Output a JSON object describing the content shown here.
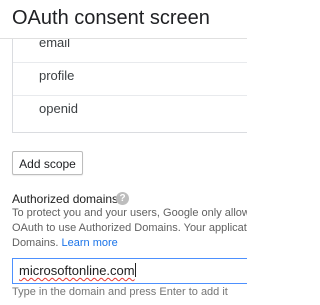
{
  "header": {
    "title": "OAuth consent screen"
  },
  "scopes": {
    "partial_item": "email",
    "items": [
      "profile",
      "openid"
    ],
    "add_button_label": "Add scope"
  },
  "authorized_domains": {
    "title": "Authorized domains",
    "help_glyph": "?",
    "description_line1": "To protect you and your users, Google only allow",
    "description_line2": "OAuth to use Authorized Domains. Your applicati",
    "description_line3_prefix": "Domains. ",
    "learn_more": "Learn more",
    "input_value": "microsoftonline.com",
    "hint": "Type in the domain and press Enter to add it"
  },
  "colors": {
    "link": "#1a73e8",
    "input_focus_border": "#4d90fe"
  },
  "icons": {
    "help": "help-circle-icon"
  }
}
